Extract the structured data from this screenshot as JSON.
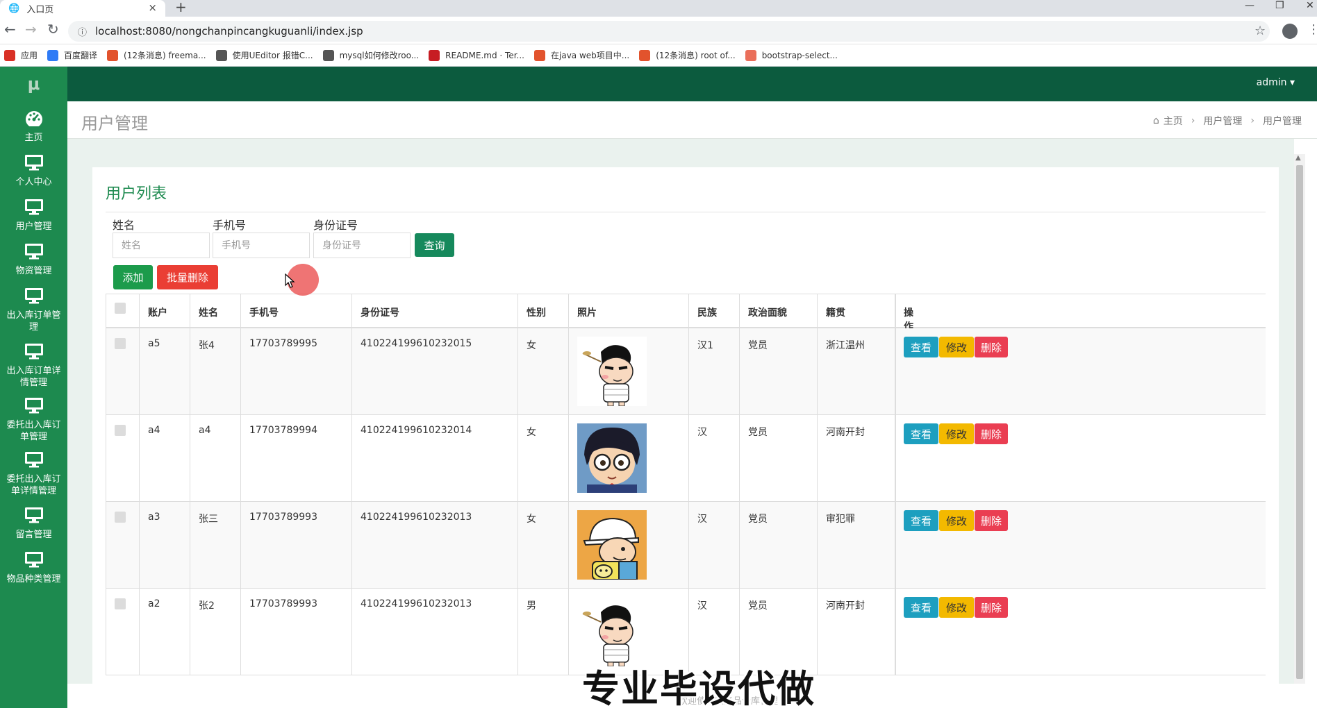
{
  "browser": {
    "tab_title": "入口页",
    "tab_close": "×",
    "new_tab": "+",
    "url": "localhost:8080/nongchanpincangkuguanli/index.jsp",
    "bookmarks": [
      {
        "label": "应用",
        "icon": "apps-grid-icon",
        "color": "#d93025"
      },
      {
        "label": "百度翻译",
        "icon": "baidu-translate-icon",
        "color": "#2e7bf6"
      },
      {
        "label": "(12条消息) freema...",
        "icon": "csdn-icon",
        "color": "#e2532d"
      },
      {
        "label": "使用UEditor 报错C...",
        "icon": "bird-icon",
        "color": "#555555"
      },
      {
        "label": "mysql如何修改roo...",
        "icon": "bird-icon",
        "color": "#555555"
      },
      {
        "label": "README.md · Ter...",
        "icon": "gitee-icon",
        "color": "#c71d23"
      },
      {
        "label": "在java web项目中...",
        "icon": "csdn-icon",
        "color": "#e2532d"
      },
      {
        "label": "(12条消息) root of...",
        "icon": "csdn-icon",
        "color": "#e2532d"
      },
      {
        "label": "bootstrap-select...",
        "icon": "jianshu-icon",
        "color": "#ea6f5a"
      }
    ]
  },
  "header": {
    "logo": "μ",
    "user": "admin ▾"
  },
  "sidebar": {
    "items": [
      {
        "label": "主页",
        "icon": "dashboard-icon"
      },
      {
        "label": "个人中心",
        "icon": "monitor-icon"
      },
      {
        "label": "用户管理",
        "icon": "monitor-icon"
      },
      {
        "label": "物资管理",
        "icon": "monitor-icon"
      },
      {
        "label": "出入库订单管理",
        "icon": "monitor-icon"
      },
      {
        "label": "出入库订单详情管理",
        "icon": "monitor-icon"
      },
      {
        "label": "委托出入库订单管理",
        "icon": "monitor-icon"
      },
      {
        "label": "委托出入库订单详情管理",
        "icon": "monitor-icon"
      },
      {
        "label": "留言管理",
        "icon": "monitor-icon"
      },
      {
        "label": "物品种类管理",
        "icon": "monitor-icon"
      }
    ]
  },
  "page": {
    "title": "用户管理",
    "breadcrumb": [
      "主页",
      "用户管理",
      "用户管理"
    ],
    "breadcrumb_sep": "›",
    "card_title": "用户列表"
  },
  "search": {
    "name_label": "姓名",
    "name_placeholder": "姓名",
    "phone_label": "手机号",
    "phone_placeholder": "手机号",
    "idcard_label": "身份证号",
    "idcard_placeholder": "身份证号",
    "query_button": "查询"
  },
  "actions": {
    "add": "添加",
    "batch_delete": "批量删除"
  },
  "table": {
    "headers": [
      "账户",
      "姓名",
      "手机号",
      "身份证号",
      "性别",
      "照片",
      "民族",
      "政治面貌",
      "籍贯",
      "操作"
    ],
    "rows": [
      {
        "account": "a5",
        "name": "张4",
        "phone": "17703789995",
        "idcard": "410224199610232015",
        "gender": "女",
        "photo": "cartoon-boy-shinchan",
        "ethnicity": "汉1",
        "politics": "党员",
        "hometown": "浙江温州"
      },
      {
        "account": "a4",
        "name": "a4",
        "phone": "17703789994",
        "idcard": "410224199610232014",
        "gender": "女",
        "photo": "cartoon-boy-conan",
        "ethnicity": "汉",
        "politics": "党员",
        "hometown": "河南开封"
      },
      {
        "account": "a3",
        "name": "张三",
        "phone": "17703789993",
        "idcard": "410224199610232013",
        "gender": "女",
        "photo": "cartoon-boy-hat",
        "ethnicity": "汉",
        "politics": "党员",
        "hometown": "审犯罪"
      },
      {
        "account": "a2",
        "name": "张2",
        "phone": "17703789993",
        "idcard": "410224199610232013",
        "gender": "男",
        "photo": "cartoon-boy-shinchan",
        "ethnicity": "汉",
        "politics": "党员",
        "hometown": "河南开封"
      }
    ],
    "op_view": "查看",
    "op_edit": "修改",
    "op_delete": "删除"
  },
  "footer": {
    "text": "欢迎使用农产品仓库管理"
  },
  "overlay": {
    "watermark": "专业毕设代做"
  },
  "colors": {
    "header_green": "#0c5b3e",
    "sidebar_green": "#1d8a4f",
    "title_green": "#1d8a4f",
    "view_blue": "#1d9fbf",
    "edit_yellow": "#f3b900",
    "delete_red": "#ea3e52"
  }
}
